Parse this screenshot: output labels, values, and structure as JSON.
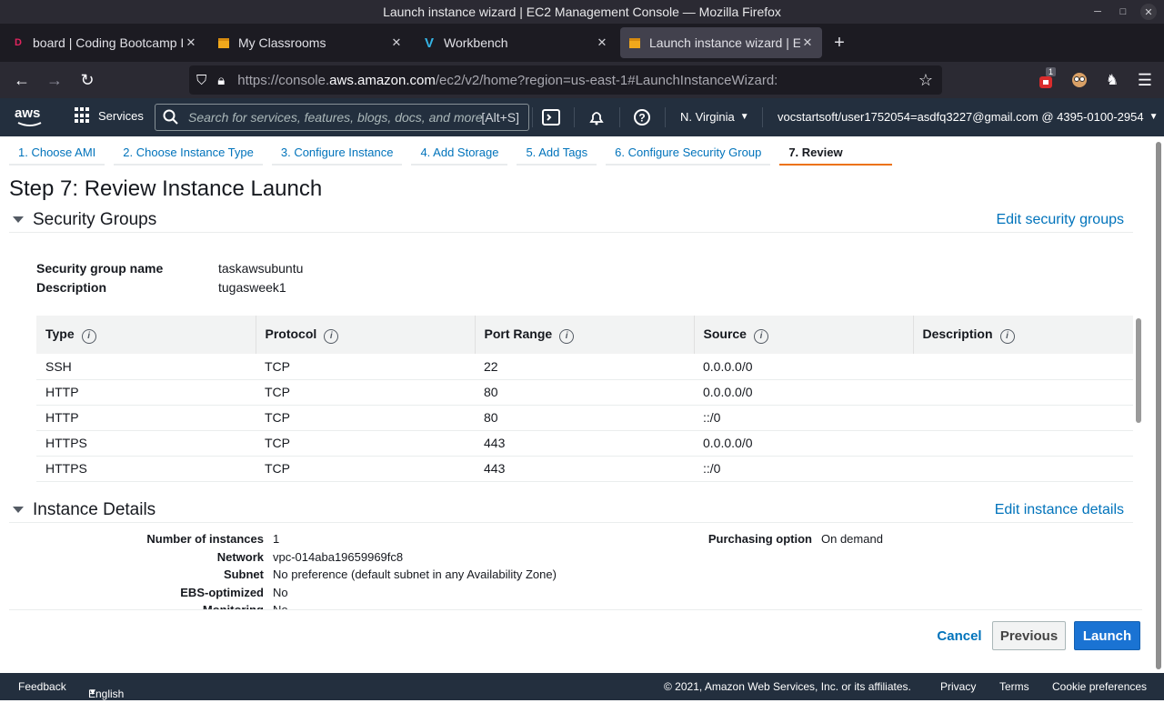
{
  "window": {
    "title": "Launch instance wizard | EC2 Management Console — Mozilla Firefox"
  },
  "tabs": [
    {
      "title": "board | Coding Bootcamp In",
      "icon": "dicoding-icon"
    },
    {
      "title": "My Classrooms",
      "icon": "aws-box-icon"
    },
    {
      "title": "Workbench",
      "icon": "vocareum-icon"
    },
    {
      "title": "Launch instance wizard | EC",
      "icon": "aws-box-icon"
    }
  ],
  "url": {
    "prefix": "https://console.",
    "host": "aws.amazon.com",
    "path": "/ec2/v2/home?region=us-east-1#LaunchInstanceWizard:"
  },
  "extension_badge": "1",
  "aws": {
    "logo": "aws",
    "services": "Services",
    "search_placeholder": "Search for services, features, blogs, docs, and more",
    "search_shortcut": "[Alt+S]",
    "region": "N. Virginia",
    "account": "vocstartsoft/user1752054=asdfq3227@gmail.com @ 4395-0100-2954"
  },
  "wizard": {
    "steps": [
      "1. Choose AMI",
      "2. Choose Instance Type",
      "3. Configure Instance",
      "4. Add Storage",
      "5. Add Tags",
      "6. Configure Security Group",
      "7. Review"
    ],
    "title": "Step 7: Review Instance Launch"
  },
  "security_groups": {
    "title": "Security Groups",
    "edit_link": "Edit security groups",
    "name_label": "Security group name",
    "name_value": "taskawsubuntu",
    "desc_label": "Description",
    "desc_value": "tugasweek1",
    "columns": [
      "Type",
      "Protocol",
      "Port Range",
      "Source",
      "Description"
    ],
    "rows": [
      [
        "SSH",
        "TCP",
        "22",
        "0.0.0.0/0",
        ""
      ],
      [
        "HTTP",
        "TCP",
        "80",
        "0.0.0.0/0",
        ""
      ],
      [
        "HTTP",
        "TCP",
        "80",
        "::/0",
        ""
      ],
      [
        "HTTPS",
        "TCP",
        "443",
        "0.0.0.0/0",
        ""
      ],
      [
        "HTTPS",
        "TCP",
        "443",
        "::/0",
        ""
      ]
    ]
  },
  "instance_details": {
    "title": "Instance Details",
    "edit_link": "Edit instance details",
    "fields": [
      {
        "label": "Number of instances",
        "value": "1"
      },
      {
        "label": "Network",
        "value": "vpc-014aba19659969fc8"
      },
      {
        "label": "Subnet",
        "value": "No preference (default subnet in any Availability Zone)"
      },
      {
        "label": "EBS-optimized",
        "value": "No"
      },
      {
        "label": "Monitoring",
        "value": "No"
      }
    ],
    "purchasing_label": "Purchasing option",
    "purchasing_value": "On demand"
  },
  "buttons": {
    "cancel": "Cancel",
    "previous": "Previous",
    "launch": "Launch"
  },
  "footer": {
    "feedback": "Feedback",
    "language": "English (US)",
    "copyright": "© 2021, Amazon Web Services, Inc. or its affiliates.",
    "privacy": "Privacy",
    "terms": "Terms",
    "cookies": "Cookie preferences"
  },
  "colors": {
    "aws_header": "#232f3e",
    "link": "#0073bb",
    "active_step": "#ec7211",
    "launch_button": "#1a73d3"
  }
}
